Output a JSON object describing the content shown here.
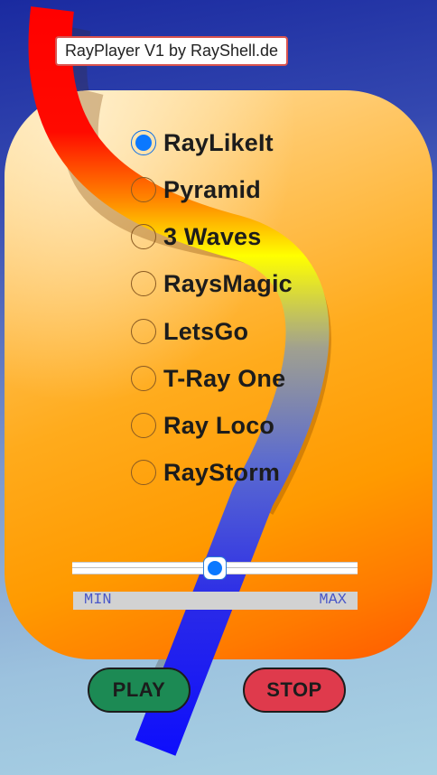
{
  "app": {
    "title": "RayPlayer V1 by RayShell.de"
  },
  "presets": [
    {
      "label": "RayLikeIt",
      "selected": true
    },
    {
      "label": "Pyramid",
      "selected": false
    },
    {
      "label": "3 Waves",
      "selected": false
    },
    {
      "label": "RaysMagic",
      "selected": false
    },
    {
      "label": "LetsGo",
      "selected": false
    },
    {
      "label": "T-Ray One",
      "selected": false
    },
    {
      "label": "Ray Loco",
      "selected": false
    },
    {
      "label": "RayStorm",
      "selected": false
    }
  ],
  "slider": {
    "value": 0.5,
    "min_label": "MIN",
    "max_label": "MAX"
  },
  "controls": {
    "play_label": "PLAY",
    "stop_label": "STOP"
  },
  "colors": {
    "play": "#1c8a54",
    "stop": "#df3a4c",
    "accent": "#0b78ff",
    "card": "#ff9a00"
  }
}
